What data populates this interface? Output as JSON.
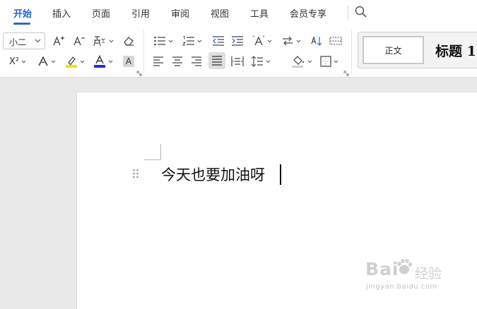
{
  "tabs": [
    {
      "label": "开始",
      "active": true
    },
    {
      "label": "插入"
    },
    {
      "label": "页面"
    },
    {
      "label": "引用"
    },
    {
      "label": "审阅"
    },
    {
      "label": "视图"
    },
    {
      "label": "工具"
    },
    {
      "label": "会员专享"
    }
  ],
  "toolbar": {
    "font_size": "小二",
    "superscript_label": "X²",
    "char_shading_label": "A",
    "font_color_label": "A",
    "highlight_color": "#f5e100",
    "font_color": "#1f2fd6",
    "accent_color": "#2b67d1"
  },
  "styles": {
    "normal": "正文",
    "heading": "标题 1"
  },
  "document": {
    "text": "今天也要加油呀"
  },
  "watermark": {
    "brand": "Bai",
    "suffix": "经验",
    "url": "jingyan.baidu.com"
  }
}
